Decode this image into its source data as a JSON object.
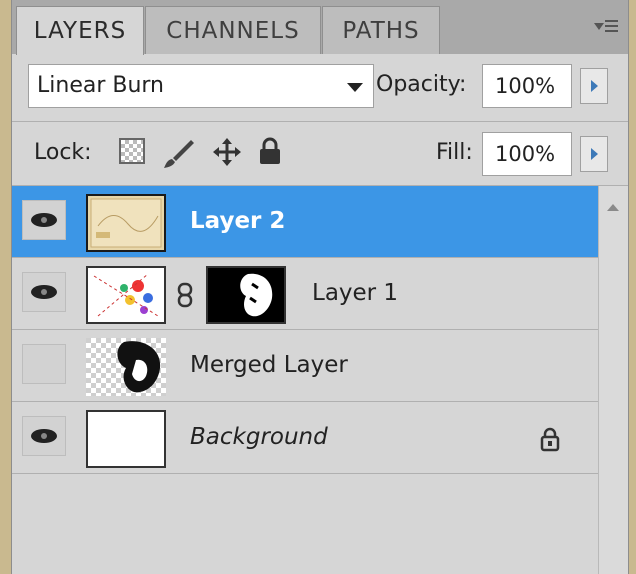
{
  "tabs": [
    {
      "label": "LAYERS",
      "active": true
    },
    {
      "label": "CHANNELS",
      "active": false
    },
    {
      "label": "PATHS",
      "active": false
    }
  ],
  "blend_mode": {
    "value": "Linear Burn"
  },
  "opacity": {
    "label": "Opacity:",
    "value": "100%"
  },
  "lock": {
    "label": "Lock:",
    "icons": [
      "lock-transparent-icon",
      "lock-image-icon",
      "lock-position-icon",
      "lock-all-icon"
    ]
  },
  "fill": {
    "label": "Fill:",
    "value": "100%"
  },
  "layers": [
    {
      "name": "Layer 2",
      "visible": true,
      "selected": true,
      "italic": false
    },
    {
      "name": "Layer 1",
      "visible": true,
      "selected": false,
      "italic": false,
      "has_mask": true
    },
    {
      "name": "Merged Layer",
      "visible": false,
      "selected": false,
      "italic": false
    },
    {
      "name": "Background",
      "visible": true,
      "selected": false,
      "italic": true,
      "locked": true
    }
  ],
  "colors": {
    "selection": "#3c96e6",
    "panel": "#d6d6d6",
    "tabbar": "#a9a9a9"
  }
}
